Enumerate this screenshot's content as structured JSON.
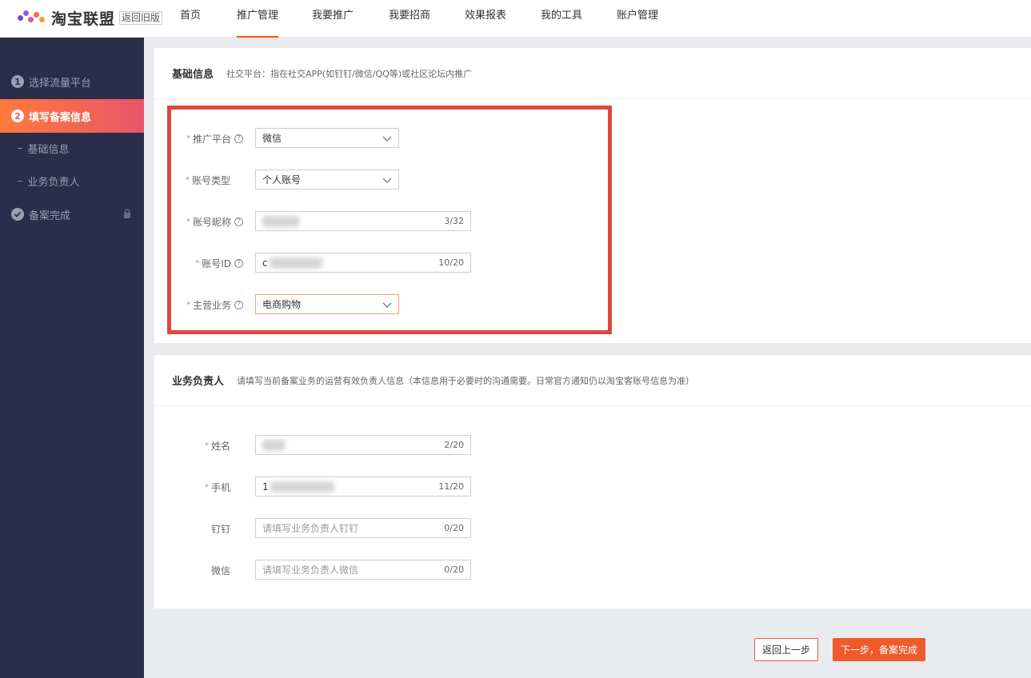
{
  "header": {
    "brand": "淘宝联盟",
    "old_version": "返回旧版",
    "nav": [
      "首页",
      "推广管理",
      "我要推广",
      "我要招商",
      "效果报表",
      "我的工具",
      "账户管理"
    ]
  },
  "sidebar": {
    "step1": {
      "num": "1",
      "label": "选择流量平台"
    },
    "step2": {
      "num": "2",
      "label": "填写备案信息"
    },
    "sub1": "基础信息",
    "sub2": "业务负责人",
    "done": "备案完成"
  },
  "basic": {
    "title": "基础信息",
    "desc": "社交平台：指在社交APP(如钉钉/微信/QQ等)或社区论坛内推广",
    "platform": {
      "label": "推广平台",
      "value": "微信"
    },
    "account_type": {
      "label": "账号类型",
      "value": "个人账号"
    },
    "nickname": {
      "label": "账号昵称",
      "count": "3/32"
    },
    "account_id": {
      "label": "账号ID",
      "prefix": "c",
      "count": "10/20"
    },
    "business": {
      "label": "主营业务",
      "value": "电商购物"
    }
  },
  "owner": {
    "title": "业务负责人",
    "desc": "请填写当前备案业务的运营有效负责人信息（本信息用于必要时的沟通需要。日常官方通知仍以淘宝客账号信息为准）",
    "name": {
      "label": "姓名",
      "count": "2/20"
    },
    "phone": {
      "label": "手机",
      "prefix": "1",
      "count": "11/20"
    },
    "dingding": {
      "label": "钉钉",
      "placeholder": "请填写业务负责人钉钉",
      "count": "0/20"
    },
    "wechat": {
      "label": "微信",
      "placeholder": "请填写业务负责人微信",
      "count": "0/20"
    }
  },
  "actions": {
    "back": "返回上一步",
    "next": "下一步，备案完成"
  },
  "colors": {
    "accent": "#ff5000",
    "sidebar": "#2b2d4a",
    "highlight": "#e0473c"
  }
}
